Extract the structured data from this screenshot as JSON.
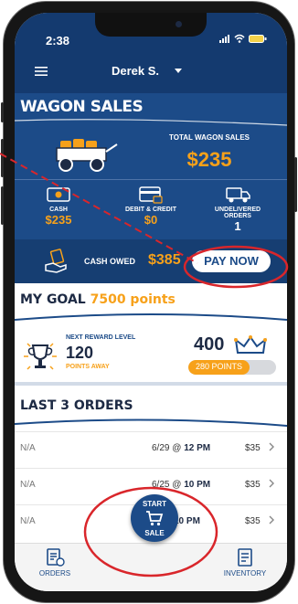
{
  "status": {
    "time": "2:38"
  },
  "header": {
    "user": "Derek S."
  },
  "wagon": {
    "title": "WAGON SALES",
    "total_label": "TOTAL WAGON SALES",
    "total_value": "$235",
    "stats": [
      {
        "label": "CASH",
        "value": "$235",
        "icon": "cash-icon",
        "color": "#f7a11a"
      },
      {
        "label": "DEBIT & CREDIT",
        "value": "$0",
        "icon": "card-icon",
        "color": "#f7a11a"
      },
      {
        "label": "UNDELIVERED ORDERS",
        "value": "1",
        "icon": "truck-icon",
        "color": "#ffffff"
      }
    ],
    "owed_label": "CASH OWED",
    "owed_value": "$385",
    "pay_now": "PAY NOW"
  },
  "goal": {
    "title_prefix": "MY GOAL",
    "title_points": "7500 points",
    "next_reward_label": "NEXT REWARD LEVEL",
    "next_reward_value": "120",
    "points_away": "POINTS AWAY",
    "current_points": "400",
    "progress_text": "280 POINTS",
    "progress_fraction": 0.7
  },
  "orders": {
    "title": "LAST 3 ORDERS",
    "rows": [
      {
        "name": "N/A",
        "date": "6/29",
        "at": "@",
        "time": "12 PM",
        "amount": "$35"
      },
      {
        "name": "N/A",
        "date": "6/25",
        "at": "@",
        "time": "10 PM",
        "amount": "$35"
      },
      {
        "name": "N/A",
        "date": "",
        "at": "",
        "time": "10 PM",
        "amount": "$35"
      }
    ]
  },
  "tabs": {
    "orders": "ORDERS",
    "inventory": "INVENTORY"
  },
  "fab": {
    "line1": "START",
    "line2": "SALE"
  },
  "colors": {
    "navy": "#1c4b88",
    "accent": "#f7a11a",
    "annotation": "#d9262b"
  }
}
